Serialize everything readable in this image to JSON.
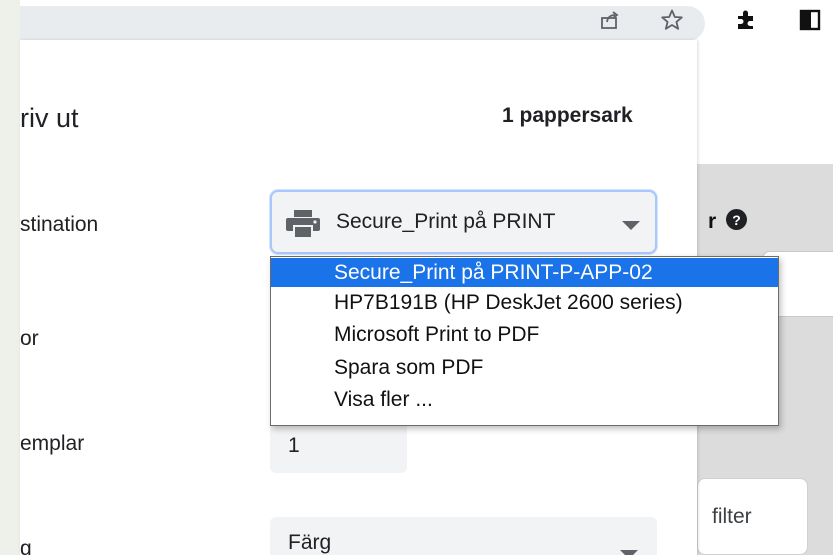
{
  "dialog": {
    "title": "riv ut",
    "sheet_count": "1 pappersark",
    "labels": {
      "destination": "stination",
      "pages": "or",
      "copies": "emplar",
      "color": "g"
    },
    "destination_value": "Secure_Print på PRINT",
    "copies_value": "1",
    "color_value": "Färg"
  },
  "dropdown": {
    "options": [
      "Secure_Print på PRINT-P-APP-02",
      "HP7B191B (HP DeskJet 2600 series)",
      "Microsoft Print to PDF",
      "Spara som PDF",
      "Visa fler ..."
    ],
    "selected_index": 0
  },
  "right_panel": {
    "partial_label": "r",
    "filter_text": "filter"
  },
  "toolbar": {
    "icons": [
      "share-icon",
      "bookmark-star-icon",
      "extensions-icon",
      "side-panel-icon"
    ]
  },
  "colors": {
    "accent": "#1a73e8",
    "focus_ring": "#a8c7fa",
    "field_bg": "#f1f3f4"
  }
}
